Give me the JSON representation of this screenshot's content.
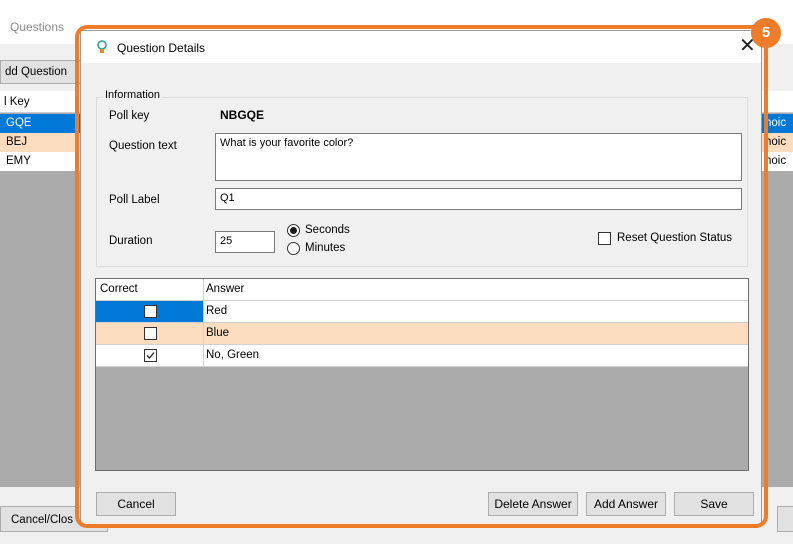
{
  "background": {
    "title": "Questions",
    "add_button": "dd Question",
    "list_header": "l Key",
    "rows": [
      {
        "key": "GQE",
        "type": "hoic"
      },
      {
        "key": "BEJ",
        "type": "hoic"
      },
      {
        "key": "EMY",
        "type": "hoic"
      }
    ],
    "cancel_button": "Cancel/Clos"
  },
  "callout_number": "5",
  "dialog": {
    "title": "Question Details",
    "group_title": "Information",
    "labels": {
      "poll_key": "Poll key",
      "question_text": "Question text",
      "poll_label": "Poll Label",
      "duration": "Duration"
    },
    "poll_key_value": "NBGQE",
    "question_text_value": "What is your favorite color?",
    "poll_label_value": "Q1",
    "duration_value": "25",
    "unit_options": [
      {
        "label": "Seconds",
        "selected": true
      },
      {
        "label": "Minutes",
        "selected": false
      }
    ],
    "reset_status_label": "Reset Question Status",
    "reset_status_checked": false,
    "grid": {
      "columns": [
        "Correct",
        "Answer"
      ],
      "rows": [
        {
          "answer": "Red",
          "correct": false,
          "state": "selected"
        },
        {
          "answer": "Blue",
          "correct": false,
          "state": "highlighted"
        },
        {
          "answer": "No, Green",
          "correct": true,
          "state": "normal"
        }
      ]
    },
    "buttons": {
      "cancel": "Cancel",
      "delete_answer": "Delete Answer",
      "add_answer": "Add Answer",
      "save": "Save"
    }
  },
  "colors": {
    "selection": "#0078d7",
    "highlight": "#fcddc0",
    "callout": "#ee7c2b"
  }
}
